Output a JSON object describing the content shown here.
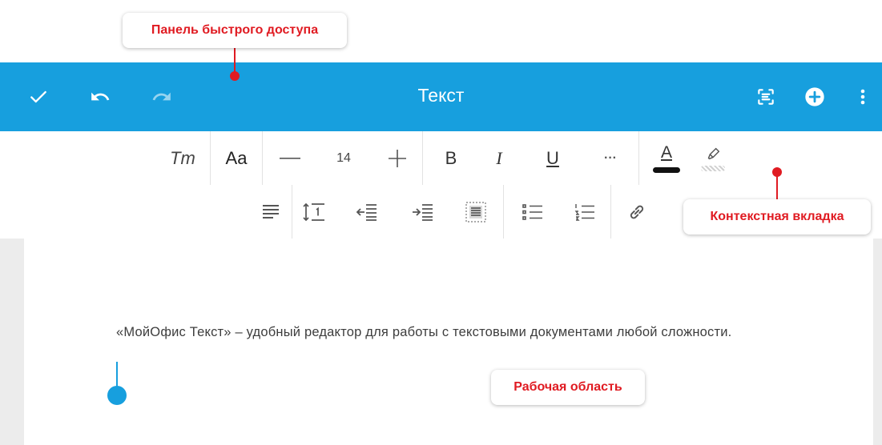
{
  "callouts": {
    "quick_access": "Панель быстрого доступа",
    "context_tab": "Контекстная вкладка",
    "workspace": "Рабочая область"
  },
  "appbar": {
    "title": "Текст",
    "color": "#179fde",
    "left_icons": [
      "check-icon",
      "undo-icon",
      "redo-icon"
    ],
    "right_icons": [
      "scan-icon",
      "add-circle-icon",
      "more-vertical-icon"
    ]
  },
  "format_toolbar": {
    "text_style_icon": "Tт",
    "font_label": "Aa",
    "font_size": "14",
    "decrease": "—",
    "increase": "+",
    "bold": "B",
    "italic": "I",
    "underline": "U",
    "more": "···",
    "font_color_letter": "A"
  },
  "paragraph_toolbar": {
    "icons": [
      "align-left-icon",
      "line-spacing-icon",
      "outdent-icon",
      "indent-icon",
      "text-wrap-icon",
      "bulleted-list-icon",
      "numbered-list-icon",
      "link-icon"
    ]
  },
  "document": {
    "text": "«МойОфис Текст» – удобный редактор для работы с текстовыми документами любой сложности."
  },
  "colors": {
    "annotation": "#e01b22",
    "cursor_handle": "#179fde"
  }
}
